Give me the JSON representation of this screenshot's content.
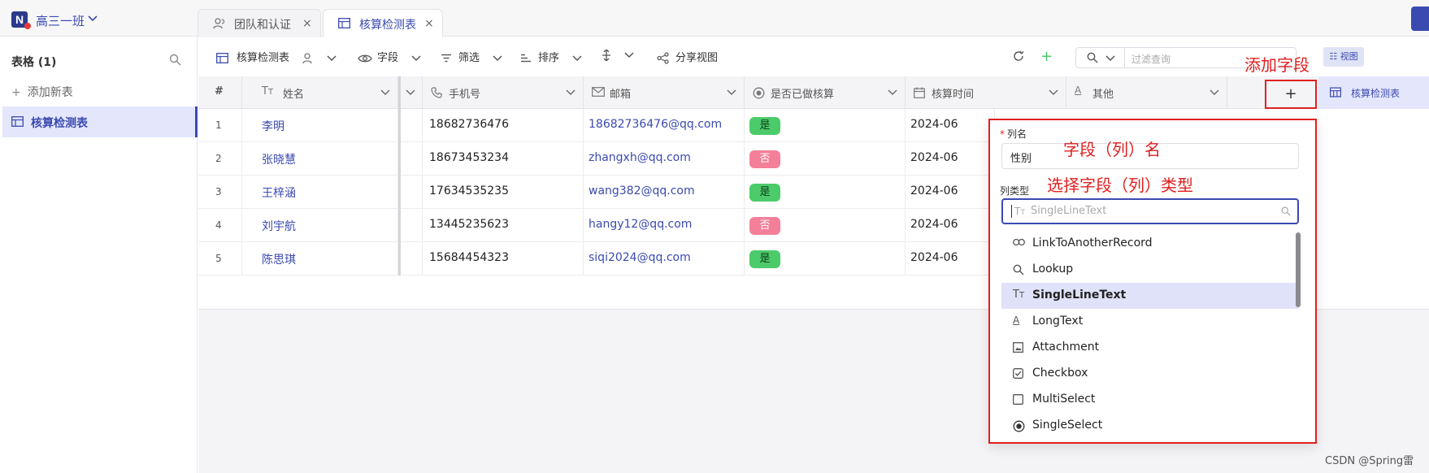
{
  "workspace": {
    "name": "高三一班"
  },
  "tabs": [
    {
      "label": "团队和认证",
      "active": false
    },
    {
      "label": "核算检测表",
      "active": true
    }
  ],
  "sidebar": {
    "title": "表格 (1)",
    "add_label": "添加新表",
    "items": [
      {
        "label": "核算检测表",
        "active": true
      }
    ]
  },
  "toolbar": {
    "table_name": "核算检测表",
    "fields": "字段",
    "filter": "筛选",
    "sort": "排序",
    "share": "分享视图",
    "search_placeholder": "过滤查询",
    "view_label": "视图"
  },
  "grid": {
    "columns": [
      {
        "label": "#",
        "icon": "hash"
      },
      {
        "label": "姓名",
        "icon": "text-icon"
      },
      {
        "label": "手机号",
        "icon": "phone-icon"
      },
      {
        "label": "邮箱",
        "icon": "mail-icon"
      },
      {
        "label": "是否已做核算",
        "icon": "radio-icon"
      },
      {
        "label": "核算时间",
        "icon": "calendar-icon"
      },
      {
        "label": "其他",
        "icon": "longtext-icon"
      }
    ],
    "rows": [
      {
        "no": "1",
        "name": "李明",
        "phone": "18682736476",
        "email": "18682736476@qq.com",
        "status": "是",
        "time": "2024-06"
      },
      {
        "no": "2",
        "name": "张晓慧",
        "phone": "18673453234",
        "email": "zhangxh@qq.com",
        "status": "否",
        "time": "2024-06"
      },
      {
        "no": "3",
        "name": "王梓涵",
        "phone": "17634535235",
        "email": "wang382@qq.com",
        "status": "是",
        "time": "2024-06"
      },
      {
        "no": "4",
        "name": "刘宇航",
        "phone": "13445235623",
        "email": "hangy12@qq.com",
        "status": "否",
        "time": "2024-06"
      },
      {
        "no": "5",
        "name": "陈思琪",
        "phone": "15684454323",
        "email": "siqi2024@qq.com",
        "status": "是",
        "time": "2024-06"
      }
    ]
  },
  "add_column": {
    "symbol": "+"
  },
  "right_pane": {
    "label": "核算检测表"
  },
  "popup": {
    "name_label": "列名",
    "required_mark": "*",
    "name_value": "性别",
    "type_label": "列类型",
    "type_placeholder": "SingleLineText",
    "options": [
      {
        "label": "LinkToAnotherRecord",
        "icon": "link-icon",
        "selected": false
      },
      {
        "label": "Lookup",
        "icon": "search-icon",
        "selected": false
      },
      {
        "label": "SingleLineText",
        "icon": "text-icon",
        "selected": true
      },
      {
        "label": "LongText",
        "icon": "longtext-icon",
        "selected": false
      },
      {
        "label": "Attachment",
        "icon": "attachment-icon",
        "selected": false
      },
      {
        "label": "Checkbox",
        "icon": "checkbox-icon",
        "selected": false
      },
      {
        "label": "MultiSelect",
        "icon": "multiselect-icon",
        "selected": false
      },
      {
        "label": "SingleSelect",
        "icon": "radio-icon",
        "selected": false
      }
    ]
  },
  "annotations": {
    "add_field": "添加字段",
    "field_name": "字段（列）名",
    "field_type": "选择字段（列）类型"
  },
  "watermark": "CSDN @Spring雷",
  "colors": {
    "accent": "#3b4ab0",
    "annotation": "#e02020",
    "yes": "#4ccb6b",
    "no": "#f47f98"
  }
}
